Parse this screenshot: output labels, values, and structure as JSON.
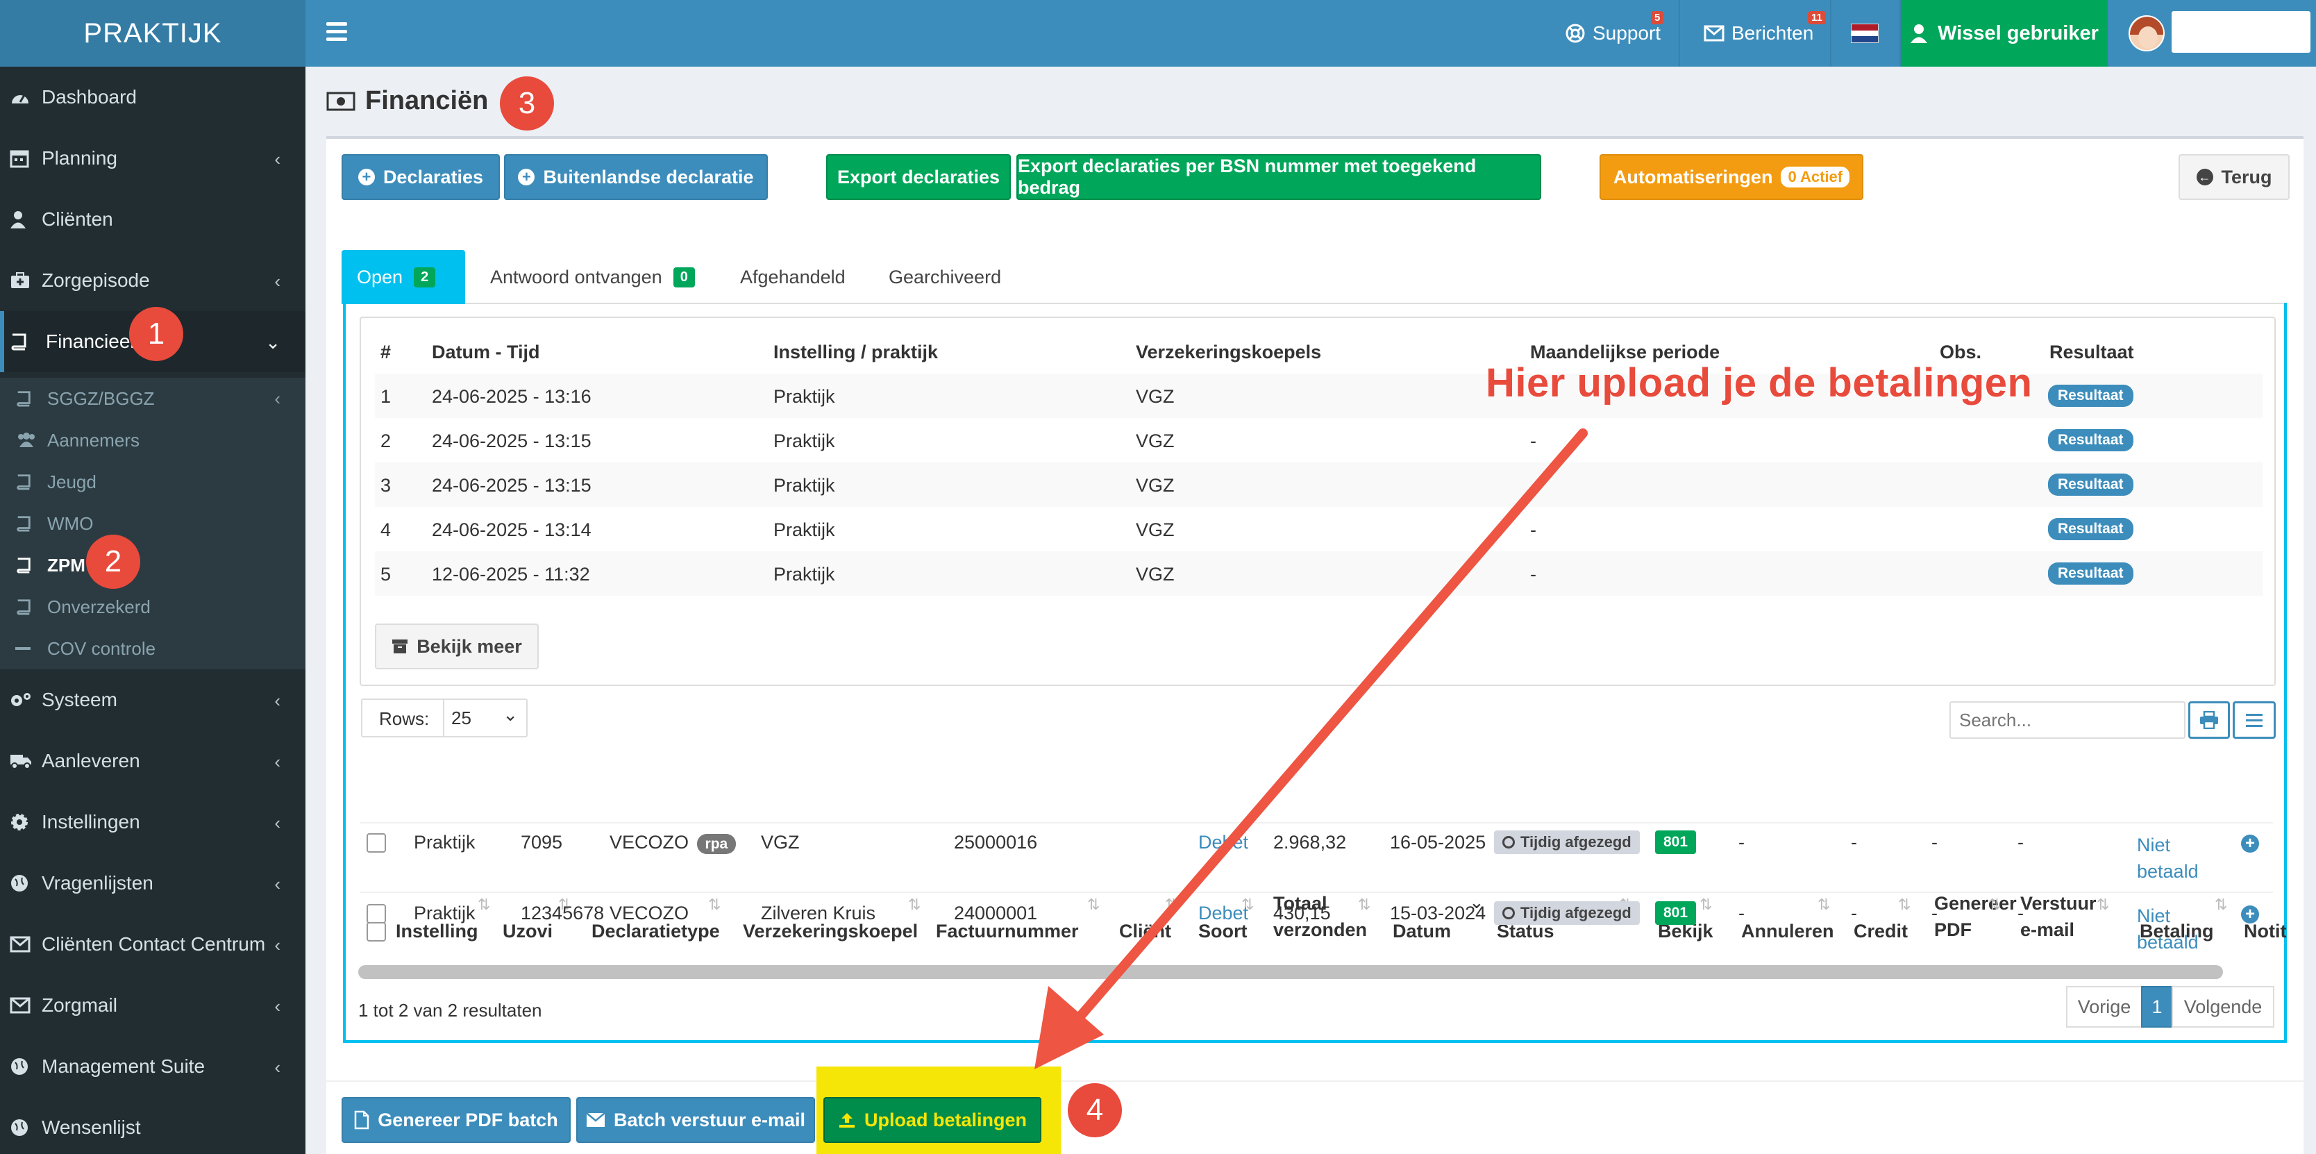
{
  "app": {
    "logo": "PRAKTIJK"
  },
  "topbar": {
    "support_label": "Support",
    "support_badge": "5",
    "berichten_label": "Berichten",
    "berichten_badge": "11",
    "switch_user_label": "Wissel gebruiker"
  },
  "sidebar": {
    "dashboard": "Dashboard",
    "planning": "Planning",
    "clienten": "Cliënten",
    "zorgepisode": "Zorgepisode",
    "financieel": "Financieel",
    "sub": {
      "sggz": "SGGZ/BGGZ",
      "aannemers": "Aannemers",
      "jeugd": "Jeugd",
      "wmo": "WMO",
      "zpm": "ZPM",
      "onverzekerd": "Onverzekerd",
      "cov": "COV controle"
    },
    "systeem": "Systeem",
    "aanleveren": "Aanleveren",
    "instellingen": "Instellingen",
    "vragenlijsten": "Vragenlijsten",
    "ccc": "Cliënten Contact Centrum",
    "zorgmail": "Zorgmail",
    "management": "Management Suite",
    "wensenlijst": "Wensenlijst"
  },
  "annotations": {
    "step1": "1",
    "step2": "2",
    "step3": "3",
    "step4": "4",
    "hint": "Hier upload je de betalingen"
  },
  "page": {
    "title": "Financiën"
  },
  "toolbar": {
    "declaraties": "Declaraties",
    "buitenlandse": "Buitenlandse declaratie",
    "export": "Export declaraties",
    "export_bsn": "Export declaraties per BSN nummer met toegekend bedrag",
    "automatiseringen": "Automatiseringen",
    "automatiseringen_badge": "0 Actief",
    "terug": "Terug"
  },
  "tabs": {
    "open": "Open",
    "open_count": "2",
    "antwoord": "Antwoord ontvangen",
    "antwoord_count": "0",
    "afgehandeld": "Afgehandeld",
    "gearchiveerd": "Gearchiveerd"
  },
  "upload_table": {
    "headers": [
      "#",
      "Datum - Tijd",
      "Instelling / praktijk",
      "Verzekeringskoepels",
      "Maandelijkse periode",
      "Obs.",
      "Resultaat"
    ],
    "rows": [
      {
        "n": "1",
        "datum": "24-06-2025 - 13:16",
        "instelling": "Praktijk",
        "koepel": "VGZ",
        "periode": "",
        "result": "Resultaat"
      },
      {
        "n": "2",
        "datum": "24-06-2025 - 13:15",
        "instelling": "Praktijk",
        "koepel": "VGZ",
        "periode": "-",
        "result": "Resultaat"
      },
      {
        "n": "3",
        "datum": "24-06-2025 - 13:15",
        "instelling": "Praktijk",
        "koepel": "VGZ",
        "periode": "",
        "result": "Resultaat"
      },
      {
        "n": "4",
        "datum": "24-06-2025 - 13:14",
        "instelling": "Praktijk",
        "koepel": "VGZ",
        "periode": "-",
        "result": "Resultaat"
      },
      {
        "n": "5",
        "datum": "12-06-2025 - 11:32",
        "instelling": "Praktijk",
        "koepel": "VGZ",
        "periode": "-",
        "result": "Resultaat"
      }
    ],
    "bekijk_meer": "Bekijk meer"
  },
  "datatable": {
    "rows_label": "Rows:",
    "rows_value": "25",
    "search_placeholder": "Search...",
    "headers": {
      "instelling": "Instelling",
      "uzovi": "Uzovi",
      "type": "Declaratietype",
      "koepel": "Verzekeringskoepel",
      "factuur": "Factuurnummer",
      "client": "Cliënt",
      "soort": "Soort",
      "totaal_1": "Totaal",
      "totaal_2": "verzonden",
      "datum": "Datum",
      "status": "Status",
      "bekijk": "Bekijk",
      "annuleren": "Annuleren",
      "credit": "Credit",
      "genereer_1": "Genereer",
      "genereer_2": "PDF",
      "verstuur_1": "Verstuur",
      "verstuur_2": "e-mail",
      "betaling": "Betaling",
      "notitie": "Notit"
    },
    "rows": [
      {
        "instelling": "Praktijk",
        "uzovi": "7095",
        "type": "VECOZO",
        "tag": "rpa",
        "koepel": "VGZ",
        "factuur": "25000016",
        "soort": "Debet",
        "totaal": "2.968,32",
        "datum": "16-05-2025",
        "status": "Tijdig afgezegd",
        "bekijk": "801",
        "annuleren": "-",
        "credit": "-",
        "genereer": "-",
        "verstuur": "-",
        "betaling_1": "Niet",
        "betaling_2": "betaald"
      },
      {
        "instelling": "Praktijk",
        "uzovi": "12345678",
        "type": "VECOZO",
        "tag": "",
        "koepel": "Zilveren Kruis",
        "factuur": "24000001",
        "soort": "Debet",
        "totaal": "430,15",
        "datum": "15-03-2024",
        "status": "Tijdig afgezegd",
        "bekijk": "801",
        "annuleren": "-",
        "credit": "-",
        "genereer": "-",
        "verstuur": "-",
        "betaling_1": "Niet",
        "betaling_2": "betaald"
      }
    ],
    "info": "1 tot 2 van 2 resultaten",
    "prev": "Vorige",
    "page": "1",
    "next": "Volgende"
  },
  "footer_buttons": {
    "pdf_batch": "Genereer PDF batch",
    "batch_email": "Batch verstuur e-mail",
    "upload": "Upload betalingen"
  },
  "colors": {
    "primary": "#3c8dbc",
    "success": "#00a65a",
    "warning": "#f39c12",
    "info": "#00c0ef",
    "annotation": "#e84a3c",
    "highlight": "#f6e608"
  }
}
